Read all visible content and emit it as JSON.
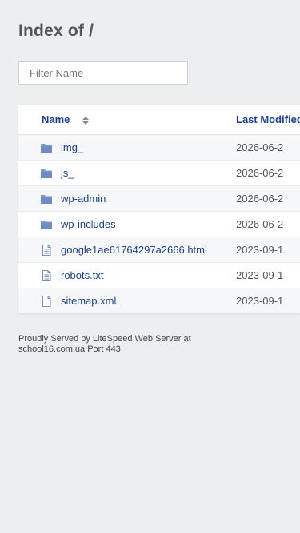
{
  "page": {
    "title": "Index of /"
  },
  "filter": {
    "placeholder": "Filter Name"
  },
  "table": {
    "headers": {
      "name": "Name",
      "last_modified": "Last Modified"
    },
    "rows": [
      {
        "name": "img_",
        "type": "folder",
        "date": "2026-06-2",
        "icon": "folder-icon"
      },
      {
        "name": "js_",
        "type": "folder",
        "date": "2026-06-2",
        "icon": "folder-icon"
      },
      {
        "name": "wp-admin",
        "type": "folder",
        "date": "2026-06-2",
        "icon": "folder-icon"
      },
      {
        "name": "wp-includes",
        "type": "folder",
        "date": "2026-06-2",
        "icon": "folder-icon"
      },
      {
        "name": "google1ae61764297a2666.html",
        "type": "text-file",
        "date": "2023-09-1",
        "icon": "text-file-icon"
      },
      {
        "name": "robots.txt",
        "type": "text-file",
        "date": "2023-09-1",
        "icon": "text-file-icon"
      },
      {
        "name": "sitemap.xml",
        "type": "file",
        "date": "2023-09-1",
        "icon": "file-icon"
      }
    ]
  },
  "footer": {
    "line1": "Proudly Served by LiteSpeed Web Server at",
    "line2": "school16.com.ua Port 443"
  },
  "colors": {
    "background": "#eceef0",
    "link": "#1d3f8f",
    "folder_icon": "#7b9ad0"
  }
}
